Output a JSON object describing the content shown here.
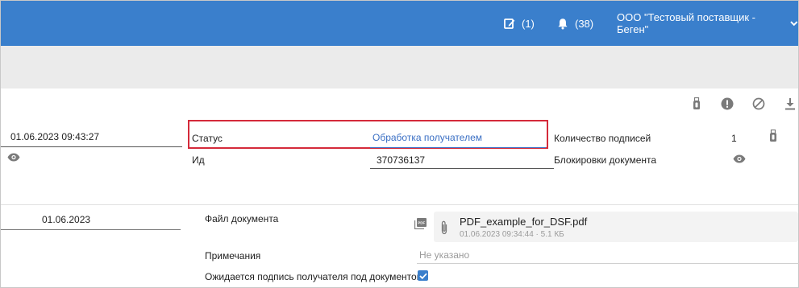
{
  "header": {
    "documents_count": "(1)",
    "notifications_count": "(38)",
    "organization": "ООО \"Тестовый поставщик - Беген\""
  },
  "toolbar": {
    "icons": [
      "usb-token-icon",
      "alert-icon",
      "block-icon",
      "download-icon"
    ]
  },
  "document": {
    "datetime": "01.06.2023 09:43:27",
    "status_label": "Статус",
    "status_value": "Обработка получателем",
    "id_label": "Ид",
    "id_value": "370736137",
    "signatures_label": "Количество подписей",
    "signatures_value": "1",
    "blocks_label": "Блокировки документа"
  },
  "details": {
    "date": "01.06.2023",
    "file_label": "Файл документа",
    "file_name": "PDF_example_for_DSF.pdf",
    "file_meta": "01.06.2023 09:34:44 · 5.1 КБ",
    "notes_label": "Примечания",
    "notes_placeholder": "Не указано",
    "signature_expected_label": "Ожидается подпись получателя под документом",
    "signature_expected_checked": true
  },
  "colors": {
    "header_bg": "#3a7fcc",
    "highlight_border": "#d42a3a",
    "link": "#3a6fc4"
  }
}
